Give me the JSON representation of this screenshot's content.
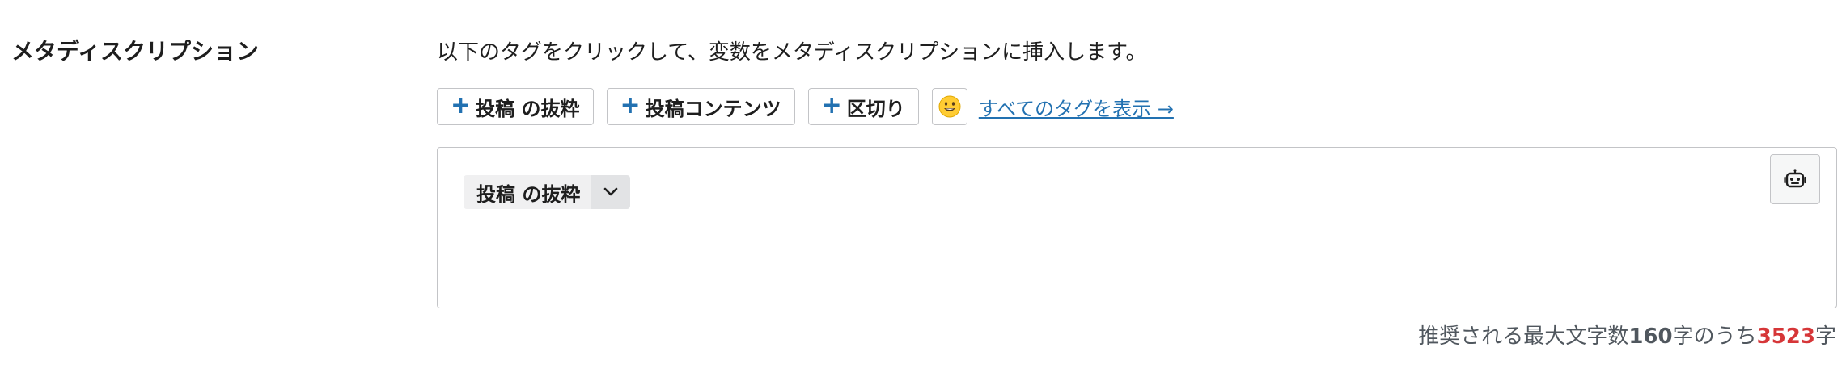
{
  "field": {
    "label": "メタディスクリプション",
    "instruction": "以下のタグをクリックして、変数をメタディスクリプションに挿入します。"
  },
  "tag_buttons": [
    {
      "plus": "+",
      "label": "投稿 の抜粋"
    },
    {
      "plus": "+",
      "label": "投稿コンテンツ"
    },
    {
      "plus": "+",
      "label": "区切り"
    }
  ],
  "emoji_button": {
    "icon": "smiley-emoji-icon"
  },
  "view_all_link": {
    "label": "すべてのタグを表示 →"
  },
  "editor": {
    "variable_chip": {
      "label": "投稿 の抜粋",
      "toggle_icon": "chevron-down-icon"
    },
    "ai_button": {
      "icon": "robot-icon"
    }
  },
  "counter": {
    "prefix": "推奨される最大文字数",
    "max": "160",
    "middle": "字のうち",
    "current": "3523",
    "suffix": "字"
  },
  "colors": {
    "accent": "#2271b1",
    "warning": "#d63638",
    "border": "#c3c4c7",
    "chip_bg": "#f0f0f1"
  }
}
